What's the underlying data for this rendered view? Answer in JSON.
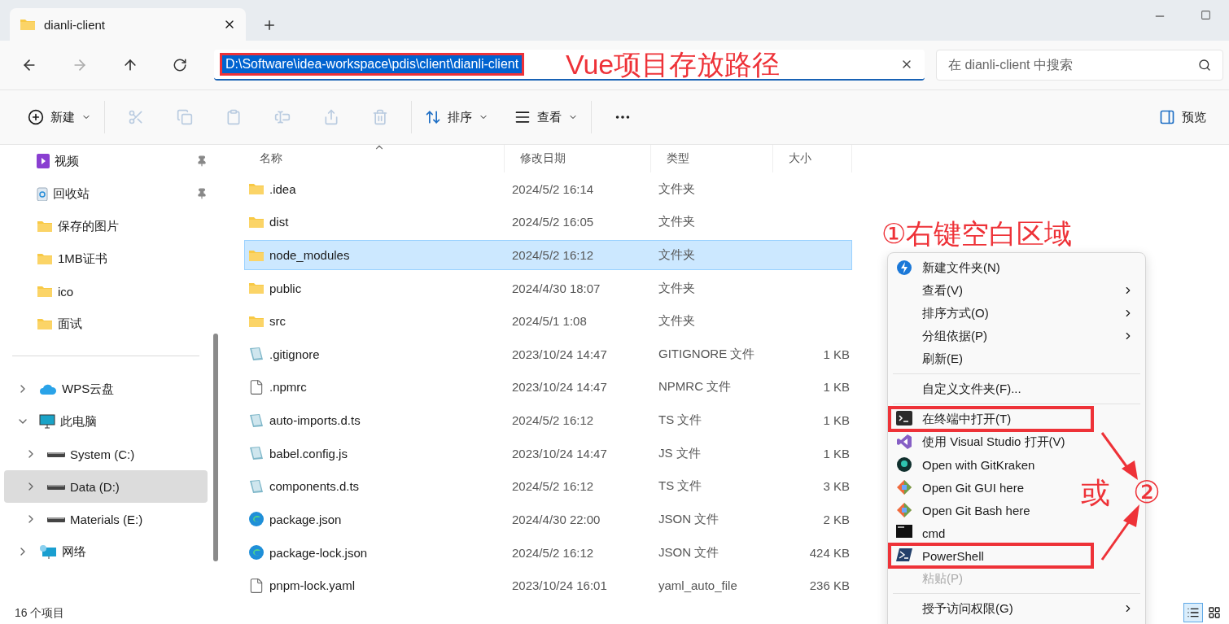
{
  "window": {
    "tab_title": "dianli-client"
  },
  "address": {
    "path": "D:\\Software\\idea-workspace\\pdis\\client\\dianli-client",
    "search_placeholder": "在 dianli-client 中搜索"
  },
  "toolbar": {
    "new_label": "新建",
    "sort_label": "排序",
    "view_label": "查看",
    "preview_label": "预览"
  },
  "sidebar": {
    "quick_access": [
      {
        "label": "视频",
        "pinned": true
      },
      {
        "label": "回收站",
        "pinned": true
      },
      {
        "label": "保存的图片",
        "pinned": false
      },
      {
        "label": "1MB证书",
        "pinned": false
      },
      {
        "label": "ico",
        "pinned": false
      },
      {
        "label": "面试",
        "pinned": false
      }
    ],
    "tree": [
      {
        "label": "WPS云盘",
        "expanded": false,
        "selected": false
      },
      {
        "label": "此电脑",
        "expanded": true,
        "selected": false,
        "children": [
          {
            "label": "System (C:)",
            "expanded": false,
            "selected": false
          },
          {
            "label": "Data (D:)",
            "expanded": false,
            "selected": true
          },
          {
            "label": "Materials (E:)",
            "expanded": false,
            "selected": false
          }
        ]
      },
      {
        "label": "网络",
        "expanded": false,
        "selected": false
      }
    ]
  },
  "table": {
    "columns": [
      "名称",
      "修改日期",
      "类型",
      "大小"
    ],
    "rows": [
      {
        "kind": "folder",
        "name": ".idea",
        "modified": "2024/5/2 16:14",
        "type": "文件夹",
        "selected": false
      },
      {
        "kind": "folder",
        "name": "dist",
        "modified": "2024/5/2 16:05",
        "type": "文件夹",
        "selected": false
      },
      {
        "kind": "folder",
        "name": "node_modules",
        "modified": "2024/5/2 16:12",
        "type": "文件夹",
        "selected": true
      },
      {
        "kind": "folder",
        "name": "public",
        "modified": "2024/4/30 18:07",
        "type": "文件夹",
        "selected": false
      },
      {
        "kind": "folder",
        "name": "src",
        "modified": "2024/5/1 1:08",
        "type": "文件夹",
        "selected": false
      },
      {
        "kind": "script",
        "name": ".gitignore",
        "modified": "2023/10/24 14:47",
        "type": "GITIGNORE 文件",
        "size": "1 KB",
        "selected": false
      },
      {
        "kind": "blank",
        "name": ".npmrc",
        "modified": "2023/10/24 14:47",
        "type": "NPMRC 文件",
        "size": "1 KB",
        "selected": false
      },
      {
        "kind": "script",
        "name": "auto-imports.d.ts",
        "modified": "2024/5/2 16:12",
        "type": "TS 文件",
        "size": "1 KB",
        "selected": false
      },
      {
        "kind": "script",
        "name": "babel.config.js",
        "modified": "2023/10/24 14:47",
        "type": "JS 文件",
        "size": "1 KB",
        "selected": false
      },
      {
        "kind": "script",
        "name": "components.d.ts",
        "modified": "2024/5/2 16:12",
        "type": "TS 文件",
        "size": "3 KB",
        "selected": false
      },
      {
        "kind": "edge",
        "name": "package.json",
        "modified": "2024/4/30 22:00",
        "type": "JSON 文件",
        "size": "2 KB",
        "selected": false
      },
      {
        "kind": "edge",
        "name": "package-lock.json",
        "modified": "2024/5/2 16:12",
        "type": "JSON 文件",
        "size": "424 KB",
        "selected": false
      },
      {
        "kind": "blank",
        "name": "pnpm-lock.yaml",
        "modified": "2023/10/24 16:01",
        "type": "yaml_auto_file",
        "size": "236 KB",
        "selected": false
      }
    ]
  },
  "status_bar": {
    "count": "16 个项目",
    "views": [
      {
        "selected": true
      },
      {
        "selected": false
      }
    ]
  },
  "context_menu": {
    "items": [
      {
        "kind": "item",
        "label": "新建文件夹(N)",
        "submenu": false,
        "disabled": false,
        "highlighted": false
      },
      {
        "kind": "item",
        "label": "查看(V)",
        "submenu": true,
        "disabled": false,
        "highlighted": false
      },
      {
        "kind": "item",
        "label": "排序方式(O)",
        "submenu": true,
        "disabled": false,
        "highlighted": false
      },
      {
        "kind": "item",
        "label": "分组依据(P)",
        "submenu": true,
        "disabled": false,
        "highlighted": false
      },
      {
        "kind": "item",
        "label": "刷新(E)",
        "submenu": false,
        "disabled": false,
        "highlighted": false
      },
      {
        "kind": "separator"
      },
      {
        "kind": "item",
        "label": "自定义文件夹(F)...",
        "submenu": false,
        "disabled": false,
        "highlighted": false
      },
      {
        "kind": "separator"
      },
      {
        "kind": "item",
        "label": "在终端中打开(T)",
        "submenu": false,
        "disabled": false,
        "highlighted": true
      },
      {
        "kind": "item",
        "label": "使用 Visual Studio 打开(V)",
        "submenu": false,
        "disabled": false,
        "highlighted": false
      },
      {
        "kind": "item",
        "label": "Open with GitKraken",
        "submenu": false,
        "disabled": false,
        "highlighted": false
      },
      {
        "kind": "item",
        "label": "Open Git GUI here",
        "submenu": false,
        "disabled": false,
        "highlighted": false
      },
      {
        "kind": "item",
        "label": "Open Git Bash here",
        "submenu": false,
        "disabled": false,
        "highlighted": false
      },
      {
        "kind": "item",
        "label": "cmd",
        "submenu": false,
        "disabled": false,
        "highlighted": false
      },
      {
        "kind": "item",
        "label": "PowerShell",
        "submenu": false,
        "disabled": false,
        "highlighted": true
      },
      {
        "kind": "item",
        "label": "粘贴(P)",
        "submenu": false,
        "disabled": true,
        "highlighted": false
      },
      {
        "kind": "separator"
      },
      {
        "kind": "item",
        "label": "授予访问权限(G)",
        "submenu": true,
        "disabled": false,
        "highlighted": false
      }
    ]
  },
  "annotations": {
    "path_note": "Vue项目存放路径",
    "step1": "①右键空白区域",
    "or_text": "或",
    "step2": "②"
  }
}
